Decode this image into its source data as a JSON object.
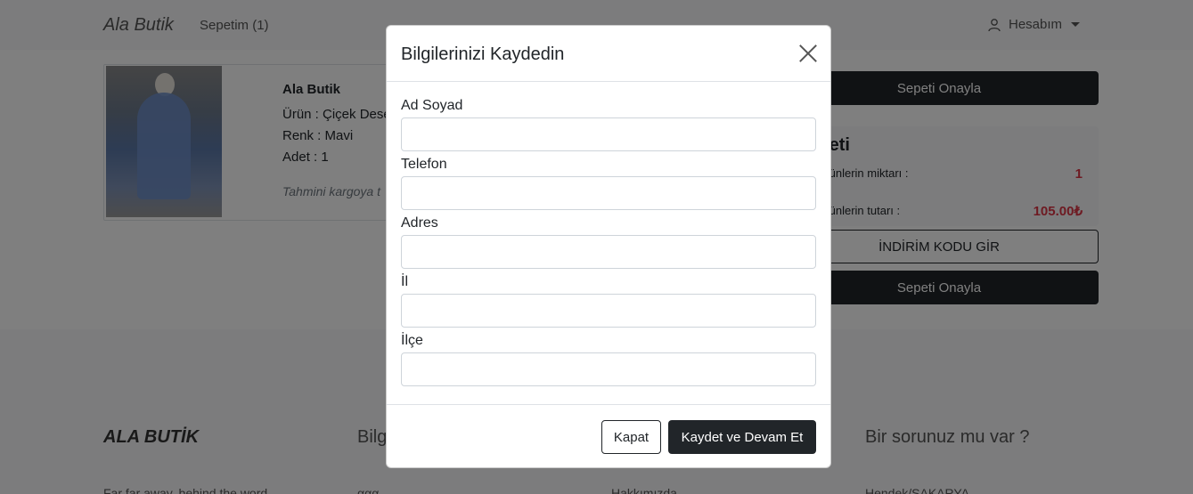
{
  "navbar": {
    "brand": "Ala Butik",
    "cart": "Sepetim (1)",
    "account": "Hesabım"
  },
  "cart_item": {
    "shop": "Ala Butik",
    "product": "Ürün : Çiçek Dese",
    "color": "Renk : Mavi",
    "quantity": "Adet : 1",
    "cargo": "Tahmini kargoya t"
  },
  "summary": {
    "confirm_top": "Sepeti Onayla",
    "title": "riş Özeti",
    "qty_label": "nizdeki ürünlerin miktarı :",
    "qty_value": "1",
    "total_label": "nizdeki ürünlerin tutarı :",
    "total_value": "105.00₺",
    "discount": "İNDİRİM KODU GİR",
    "confirm_bottom": "Sepeti Onayla"
  },
  "footer": {
    "brand": "ALA BUTİK",
    "col2_head": "Bilg",
    "col4_head": "Bir sorunuz mu var ?",
    "text1": "Far far away, behind the word",
    "text2": "ααα",
    "text3": "Hakkımızda",
    "text4": "Hendek/SAKARYA"
  },
  "modal": {
    "title": "Bilgilerinizi Kaydedin",
    "fields": [
      {
        "label": "Ad Soyad",
        "value": ""
      },
      {
        "label": "Telefon",
        "value": ""
      },
      {
        "label": "Adres",
        "value": ""
      },
      {
        "label": "İl",
        "value": ""
      },
      {
        "label": "İlçe",
        "value": ""
      }
    ],
    "close_label": "Kapat",
    "save_label": "Kaydet ve Devam Et"
  },
  "colors": {
    "dark": "#212529",
    "price_red": "#dc3545",
    "backdrop": "rgba(0,0,0,0.5)"
  }
}
